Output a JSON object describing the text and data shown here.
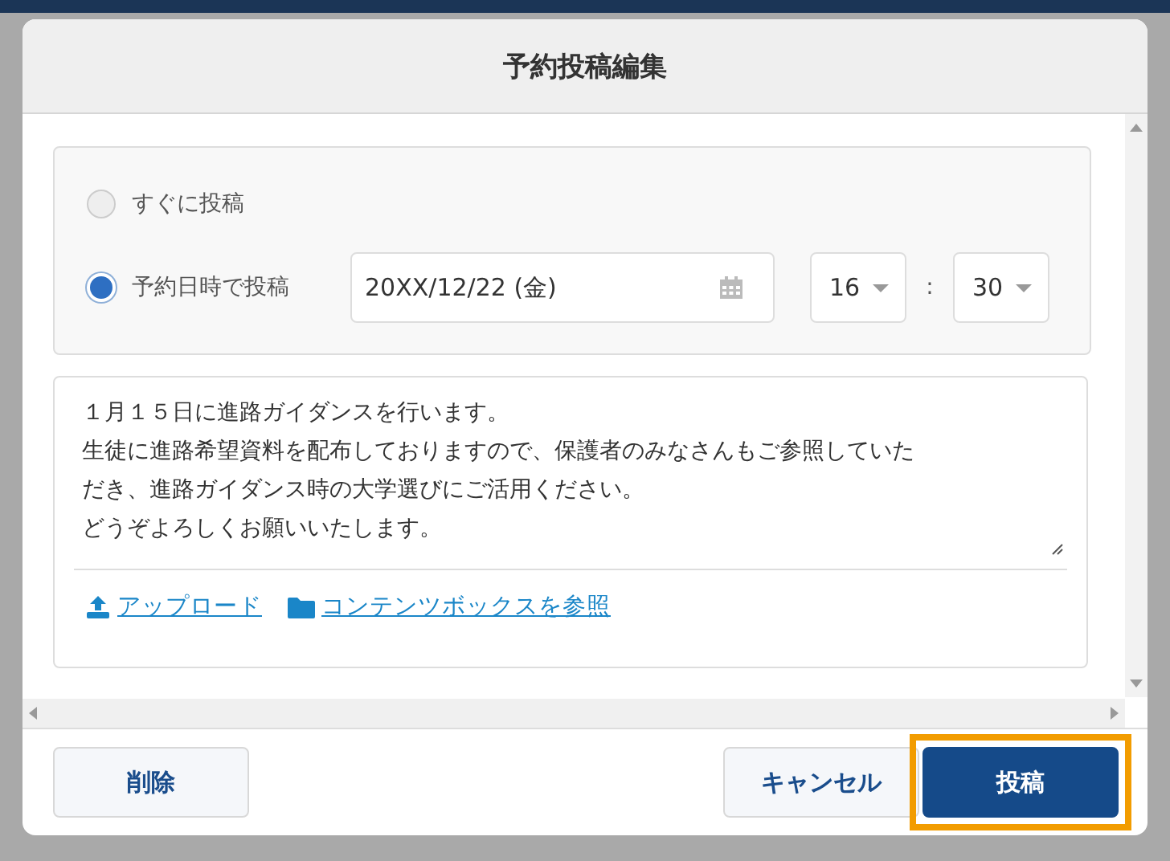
{
  "dialog": {
    "title": "予約投稿編集"
  },
  "post_timing": {
    "options": [
      {
        "label": "すぐに投稿",
        "selected": false
      },
      {
        "label": "予約日時で投稿",
        "selected": true
      }
    ],
    "date": "20XX/12/22 (金)",
    "hour": "16",
    "separator": ":",
    "minute": "30"
  },
  "message": {
    "paragraphs": [
      "１月１５日に進路ガイダンスを行います。",
      "生徒に進路希望資料を配布しておりますので、保護者のみなさんもご参照していただき、進路ガイダンス時の大学選びにご活用ください。",
      "どうぞよろしくお願いいたします。"
    ]
  },
  "attachments": [
    {
      "kind": "upload",
      "label": "アップロード"
    },
    {
      "kind": "folder",
      "label": "コンテンツボックスを参照"
    }
  ],
  "buttons": [
    {
      "label": "削除",
      "kind": "secondary",
      "highlighted": false
    },
    {
      "label": "キャンセル",
      "kind": "secondary",
      "highlighted": false
    },
    {
      "label": "投稿",
      "kind": "primary",
      "highlighted": true
    }
  ]
}
